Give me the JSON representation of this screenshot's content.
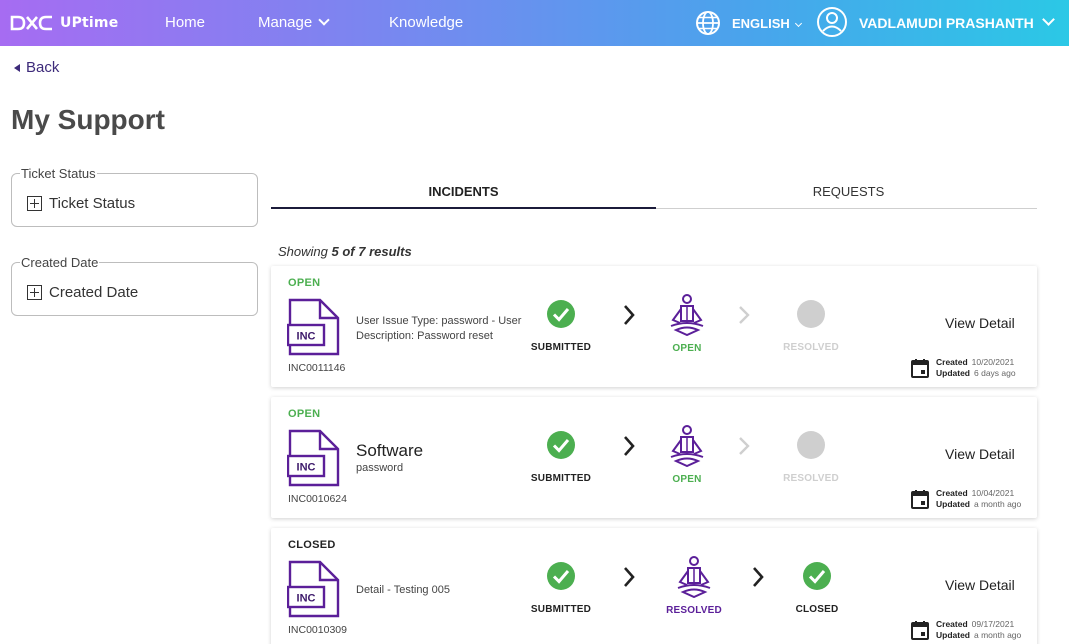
{
  "nav": {
    "logo_text": "UPtime",
    "home": "Home",
    "manage": "Manage",
    "knowledge": "Knowledge",
    "language": "ENGLISH",
    "username": "VADLAMUDI PRASHANTH",
    "gradient_colors": [
      "#a66cf2",
      "#49a4ec",
      "#2bc8e6"
    ]
  },
  "back": "Back",
  "page_title": "My Support",
  "filters": {
    "status_legend": "Ticket Status",
    "status_label": "Ticket Status",
    "date_legend": "Created Date",
    "date_label": "Created Date"
  },
  "tabs": {
    "incidents": "INCIDENTS",
    "requests": "REQUESTS"
  },
  "showing": {
    "prefix": "Showing",
    "count": "5 of 7 results"
  },
  "colors": {
    "accent_purple": "#5b1f99",
    "green": "#4caf50",
    "grey": "#cfcfcf"
  },
  "tickets": [
    {
      "state": "OPEN",
      "icon_text": "INC",
      "number": "INC0011146",
      "line1": "User Issue Type: password - User",
      "line2": "Description: Password reset",
      "steps": [
        "SUBMITTED",
        "OPEN",
        "RESOLVED"
      ],
      "view": "View Detail",
      "created_label": "Created",
      "created": "10/20/2021",
      "updated_label": "Updated",
      "updated": "6 days ago"
    },
    {
      "state": "OPEN",
      "icon_text": "INC",
      "number": "INC0010624",
      "title": "Software",
      "subtitle": "password",
      "steps": [
        "SUBMITTED",
        "OPEN",
        "RESOLVED"
      ],
      "view": "View Detail",
      "created_label": "Created",
      "created": "10/04/2021",
      "updated_label": "Updated",
      "updated": "a month ago"
    },
    {
      "state": "CLOSED",
      "icon_text": "INC",
      "number": "INC0010309",
      "line1": "Detail - Testing 005",
      "steps": [
        "SUBMITTED",
        "RESOLVED",
        "CLOSED"
      ],
      "view": "View Detail",
      "created_label": "Created",
      "created": "09/17/2021",
      "updated_label": "Updated",
      "updated": "a month ago"
    }
  ]
}
